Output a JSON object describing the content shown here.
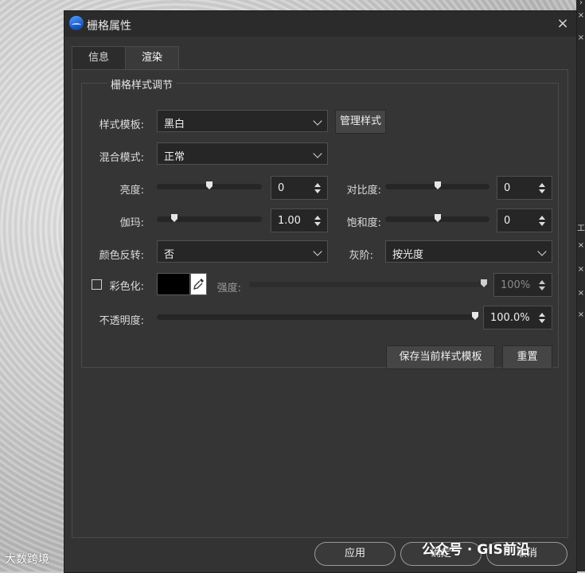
{
  "background": {
    "watermark_left": "大数跨境",
    "watermark_right": "公众号 · GIS前沿",
    "right_strip_marks": [
      "›",
      "×",
      "×",
      "工",
      "×",
      "×",
      "×",
      "×"
    ]
  },
  "dialog": {
    "title": "栅格属性",
    "close_icon": "×",
    "tabs": [
      {
        "label": "信息",
        "active": false
      },
      {
        "label": "渲染",
        "active": true
      }
    ],
    "group_title": "栅格样式调节",
    "style_template": {
      "label": "样式模板:",
      "value": "黑白",
      "manage_button": "管理样式"
    },
    "blend_mode": {
      "label": "混合模式:",
      "value": "正常"
    },
    "brightness": {
      "label": "亮度:",
      "value": "0",
      "slider_fraction": 0.5
    },
    "contrast": {
      "label": "对比度:",
      "value": "0",
      "slider_fraction": 0.5
    },
    "gamma": {
      "label": "伽玛:",
      "value": "1.00",
      "slider_fraction": 0.14
    },
    "saturation": {
      "label": "饱和度:",
      "value": "0",
      "slider_fraction": 0.5
    },
    "color_invert": {
      "label": "颜色反转:",
      "value": "否"
    },
    "grayscale": {
      "label": "灰阶:",
      "value": "按光度"
    },
    "colorize": {
      "label": "彩色化:",
      "checked": false,
      "color": "#000000",
      "strength_label": "强度:",
      "strength_value": "100%",
      "slider_fraction": 1.0
    },
    "opacity": {
      "label": "不透明度:",
      "value": "100.0%",
      "slider_fraction": 1.0
    },
    "save_template_button": "保存当前样式模板",
    "reset_button": "重置",
    "footer": {
      "apply": "应用",
      "ok": "确定",
      "cancel": "取消"
    }
  },
  "colors": {
    "dialog_bg": "#333333",
    "input_bg": "#262626",
    "button_bg": "#454545"
  }
}
